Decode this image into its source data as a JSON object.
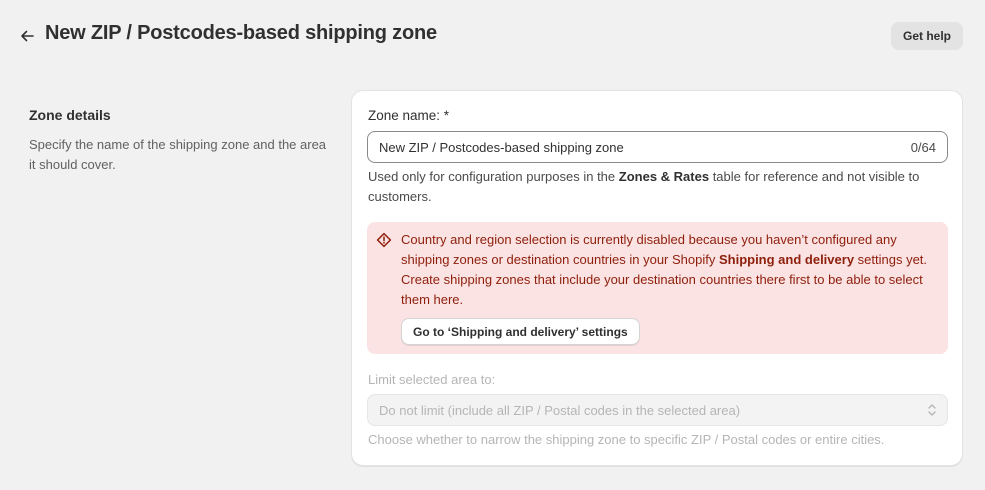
{
  "header": {
    "back_icon": "arrow-left-icon",
    "title": "New ZIP / Postcodes-based shipping zone",
    "help_label": "Get help"
  },
  "section": {
    "title": "Zone details",
    "description": "Specify the name of the shipping zone and the area it should cover."
  },
  "zone_name": {
    "label": "Zone name: *",
    "value": "New ZIP / Postcodes-based shipping zone",
    "char_count": "0/64",
    "help_prefix": "Used only for configuration purposes in the ",
    "help_bold": "Zones & Rates",
    "help_suffix": " table for reference and not visible to customers."
  },
  "banner": {
    "icon": "alert-diamond-icon",
    "text_prefix": "Country and region selection is currently disabled because you haven’t configured any shipping zones or destination countries in your Shopify ",
    "text_bold": "Shipping and delivery",
    "text_suffix": " settings yet. Create shipping zones that include your destination countries there first to be able to select them here.",
    "button_label": "Go to ‘Shipping and delivery’ settings",
    "color_bg": "#fbe2e3",
    "color_text": "#8e1f0b"
  },
  "limit_area": {
    "label": "Limit selected area to:",
    "selected": "Do not limit (include all ZIP / Postal codes in the selected area)",
    "help": "Choose whether to narrow the shipping zone to specific ZIP / Postal codes or entire cities.",
    "chevron_icon": "select-chevron-icon"
  }
}
